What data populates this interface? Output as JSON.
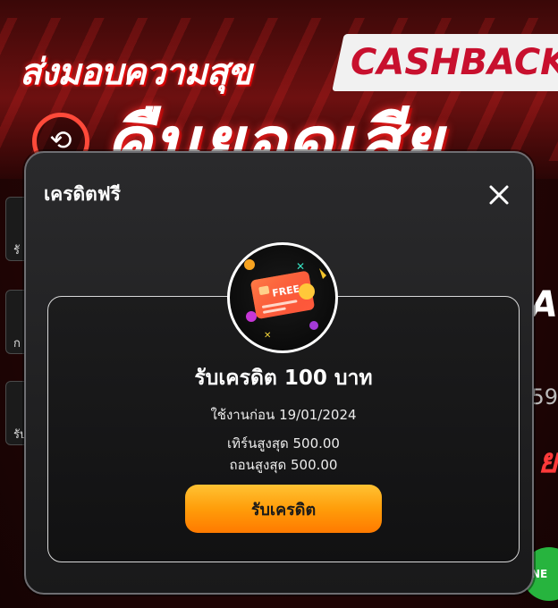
{
  "banner": {
    "headline_top": "ส่งมอบความสุข",
    "badge": "CASHBACK",
    "headline_big": "คืนยอดเสีย"
  },
  "background_tiles": [
    "รั",
    "ก",
    "รับ"
  ],
  "right_edge": {
    "text_a": "PA",
    "text_b": "59",
    "text_c": "ย"
  },
  "line_badge": "NE",
  "modal": {
    "title": "เครดิตฟรี",
    "close_label": "×",
    "card": {
      "graphic_label": "FREE",
      "title": "รับเครดิต 100 บาท",
      "use_before": "ใช้งานก่อน 19/01/2024",
      "max_turnover": "เทิร์นสูงสุด 500.00",
      "max_withdraw": "ถอนสูงสุด 500.00",
      "claim_button": "รับเครดิต"
    }
  },
  "colors": {
    "accent_orange": "#ff9d0a",
    "modal_bg": "#1f1f20",
    "banner_red": "#c8102e",
    "line_green": "#27b43e"
  }
}
